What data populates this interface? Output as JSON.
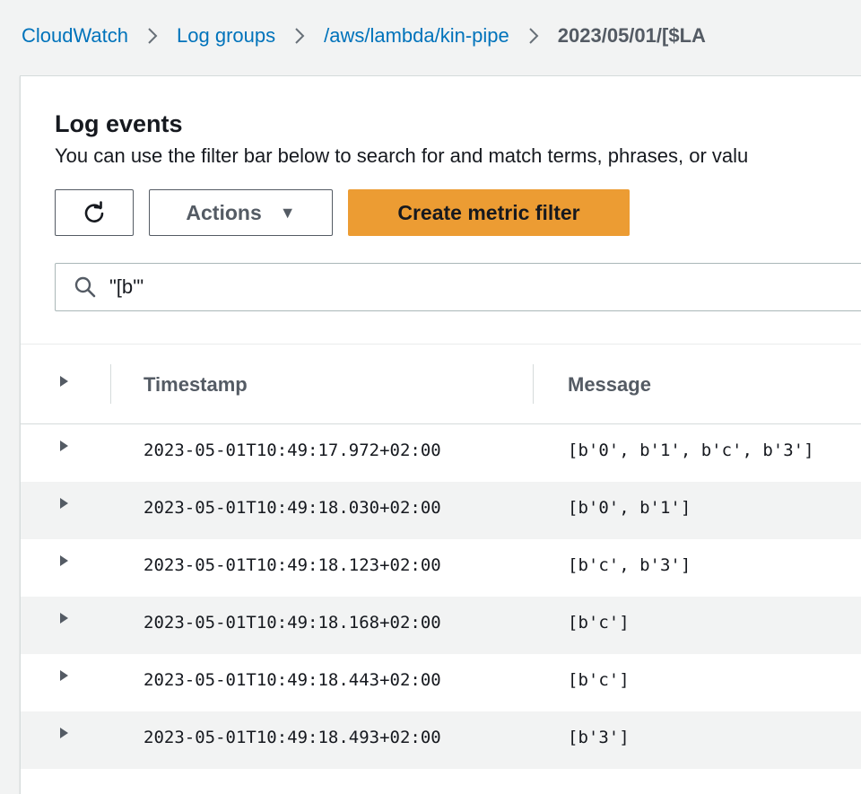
{
  "breadcrumb": {
    "items": [
      "CloudWatch",
      "Log groups",
      "/aws/lambda/kin-pipe"
    ],
    "current": "2023/05/01/[$LA"
  },
  "panel": {
    "title": "Log events",
    "description": "You can use the filter bar below to search for and match terms, phrases, or valu"
  },
  "toolbar": {
    "refresh_icon": "refresh-icon",
    "actions_label": "Actions",
    "create_metric_filter_label": "Create metric filter"
  },
  "filter": {
    "value": "\"[b'\""
  },
  "table": {
    "columns": [
      "Timestamp",
      "Message"
    ],
    "rows": [
      {
        "timestamp": "2023-05-01T10:49:17.972+02:00",
        "message": "[b'0', b'1', b'c', b'3']"
      },
      {
        "timestamp": "2023-05-01T10:49:18.030+02:00",
        "message": "[b'0', b'1']"
      },
      {
        "timestamp": "2023-05-01T10:49:18.123+02:00",
        "message": "[b'c', b'3']"
      },
      {
        "timestamp": "2023-05-01T10:49:18.168+02:00",
        "message": "[b'c']"
      },
      {
        "timestamp": "2023-05-01T10:49:18.443+02:00",
        "message": "[b'c']"
      },
      {
        "timestamp": "2023-05-01T10:49:18.493+02:00",
        "message": "[b'3']"
      }
    ]
  },
  "colors": {
    "link": "#0073bb",
    "primary_button": "#ec9c33",
    "row_alt": "#f2f3f3"
  }
}
